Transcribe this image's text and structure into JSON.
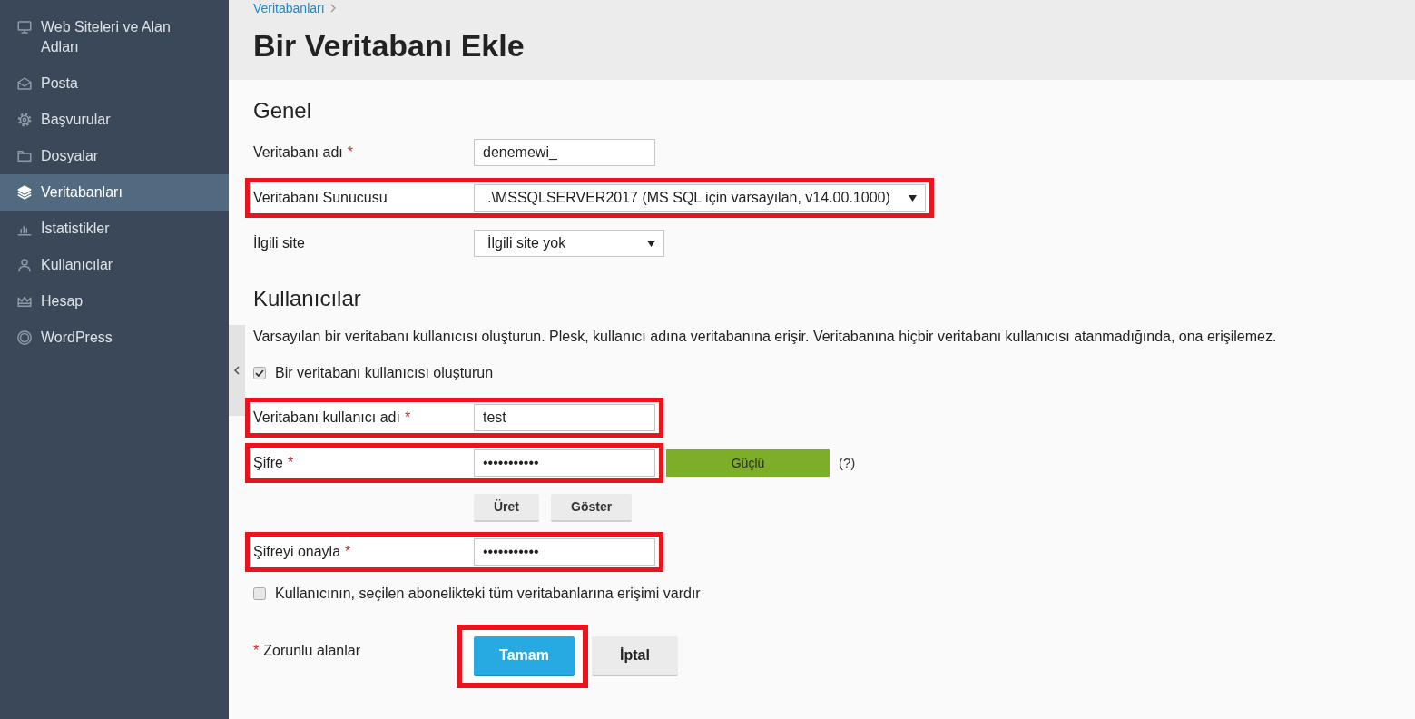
{
  "sidebar": {
    "items": [
      {
        "label": "Web Siteleri ve Alan Adları",
        "selected": false
      },
      {
        "label": "Posta",
        "selected": false
      },
      {
        "label": "Başvurular",
        "selected": false
      },
      {
        "label": "Dosyalar",
        "selected": false
      },
      {
        "label": "Veritabanları",
        "selected": true
      },
      {
        "label": "İstatistikler",
        "selected": false
      },
      {
        "label": "Kullanıcılar",
        "selected": false
      },
      {
        "label": "Hesap",
        "selected": false
      },
      {
        "label": "WordPress",
        "selected": false
      }
    ]
  },
  "page_header": {
    "breadcrumb": [
      "Veritabanları"
    ],
    "title": "Bir Veritabanı Ekle"
  },
  "general": {
    "heading": "Genel",
    "fields": [
      {
        "kind": "text",
        "label": "Veritabanı adı",
        "required_mark": "*",
        "value": "denemewi_",
        "highlighted": false
      },
      {
        "kind": "select",
        "label": "Veritabanı Sunucusu",
        "value": ".\\MSSQLSERVER2017 (MS SQL için varsayılan, v14.00.1000)",
        "highlighted": true
      },
      {
        "kind": "select",
        "label": "İlgili site",
        "value": "İlgili site yok",
        "highlighted": false
      }
    ]
  },
  "users": {
    "heading": "Kullanıcılar",
    "description": "Varsayılan bir veritabanı kullanıcısı oluşturun. Plesk, kullanıcı adına veritabanına erişir. Veritabanına hiçbir veritabanı kullanıcısı atanmadığında, ona erişilemez.",
    "create_user": {
      "label": "Bir veritabanı kullanıcısı oluşturun",
      "checked": true
    },
    "fields": [
      {
        "kind": "text",
        "label": "Veritabanı kullanıcı adı",
        "required_mark": "*",
        "value": "test",
        "highlighted": true
      },
      {
        "kind": "password",
        "label": "Şifre",
        "required_mark": "*",
        "value": "•••••••••••",
        "highlighted": true,
        "strength": "Güçlü",
        "help": "(?)"
      },
      {
        "kind": "buttons",
        "buttons": [
          "Üret",
          "Göster"
        ]
      },
      {
        "kind": "password",
        "label": "Şifreyi onayla",
        "required_mark": "*",
        "value": "•••••••••••",
        "highlighted": true
      }
    ],
    "access_all": {
      "label": "Kullanıcının, seçilen abonelikteki tüm veritabanlarına erişimi vardır",
      "checked": false
    }
  },
  "footer": {
    "required_note": {
      "mark": "*",
      "text": "Zorunlu alanlar"
    },
    "buttons": [
      {
        "kind": "primary",
        "label": "Tamam",
        "highlighted": true
      },
      {
        "kind": "secondary",
        "label": "İptal",
        "highlighted": false
      }
    ]
  }
}
